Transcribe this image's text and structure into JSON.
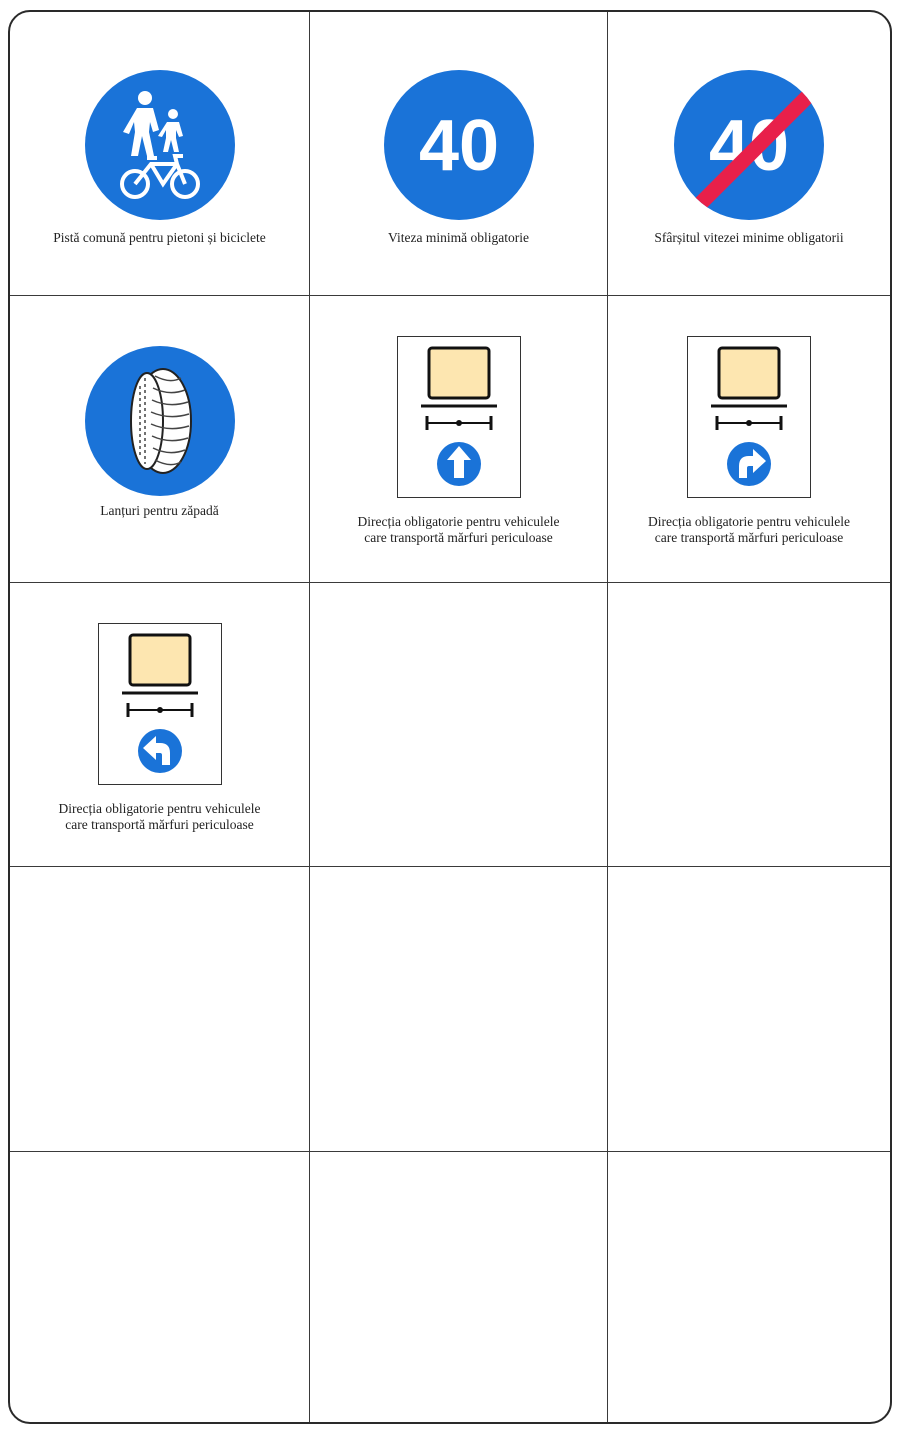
{
  "colors": {
    "sign_blue": "#1a73d8",
    "end_red": "#e8204a",
    "cargo_fill": "#fde6b0",
    "ink": "#111111"
  },
  "signs": [
    {
      "id": "shared-path",
      "icon": "pedestrian-bicycle-icon",
      "caption": "Pistă comună pentru pietoni și biciclete"
    },
    {
      "id": "min-speed",
      "icon": "speed-40-icon",
      "speed": "40",
      "caption": "Viteza minimă obligatorie"
    },
    {
      "id": "end-min-speed",
      "icon": "speed-40-end-icon",
      "speed": "40",
      "caption": "Sfârșitul vitezei minime obligatorii"
    },
    {
      "id": "snow-chains",
      "icon": "snow-chain-tire-icon",
      "caption": "Lanțuri pentru zăpadă"
    },
    {
      "id": "dangerous-straight",
      "icon": "arrow-up-icon",
      "caption_line1": "Direcția obligatorie pentru vehiculele",
      "caption_line2": "care transportă mărfuri periculoase"
    },
    {
      "id": "dangerous-right",
      "icon": "arrow-right-turn-icon",
      "caption_line1": "Direcția obligatorie pentru vehiculele",
      "caption_line2": "care transportă mărfuri periculoase"
    },
    {
      "id": "dangerous-left",
      "icon": "arrow-left-turn-icon",
      "caption_line1": "Direcția obligatorie pentru vehiculele",
      "caption_line2": "care transportă mărfuri periculoase"
    }
  ]
}
